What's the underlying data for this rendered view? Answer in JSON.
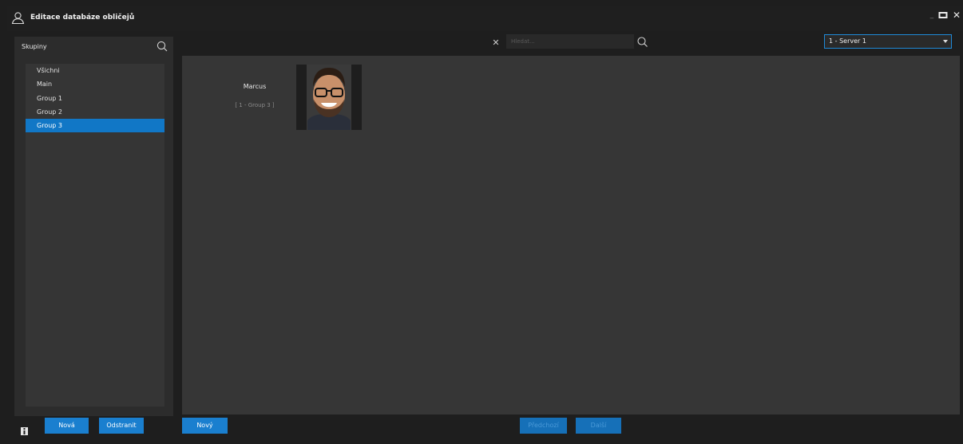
{
  "window": {
    "title": "Editace databáze obličejů"
  },
  "groups_panel": {
    "header": "Skupiny",
    "items": [
      {
        "label": "Všichni",
        "selected": false
      },
      {
        "label": "Main",
        "selected": false
      },
      {
        "label": "Group 1",
        "selected": false
      },
      {
        "label": "Group 2",
        "selected": false
      },
      {
        "label": "Group 3",
        "selected": true
      }
    ]
  },
  "search": {
    "placeholder": "Hledat...",
    "value": ""
  },
  "server": {
    "selected": "1 - Server 1"
  },
  "faces": [
    {
      "name": "Marcus",
      "group": "[ 1 - Group 3 ]"
    }
  ],
  "bottom": {
    "new_group": "Nová",
    "remove_group": "Odstranit",
    "new_face": "Nový",
    "previous": "Předchozí",
    "next": "Další"
  },
  "colors": {
    "accent": "#1a7fcf",
    "selection": "#1177c6",
    "background": "#1e1e1e",
    "panel": "#363636"
  },
  "icons": [
    "user-icon",
    "search-icon",
    "clear-icon",
    "dropdown-caret-icon",
    "info-icon",
    "minimize-icon",
    "maximize-icon",
    "close-icon"
  ]
}
